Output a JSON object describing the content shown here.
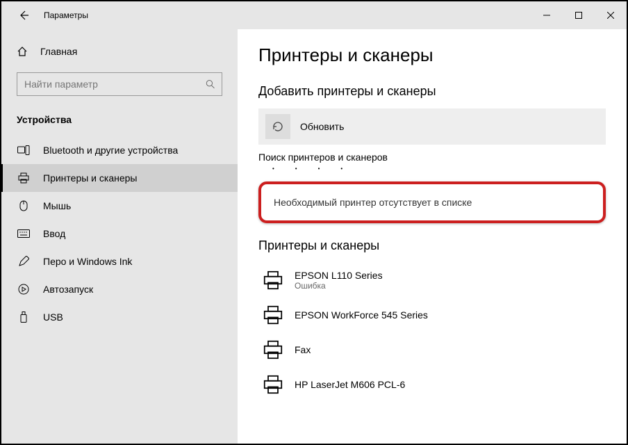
{
  "window": {
    "title": "Параметры"
  },
  "sidebar": {
    "home": "Главная",
    "search_placeholder": "Найти параметр",
    "section": "Устройства",
    "items": [
      {
        "label": "Bluetooth и другие устройства"
      },
      {
        "label": "Принтеры и сканеры"
      },
      {
        "label": "Мышь"
      },
      {
        "label": "Ввод"
      },
      {
        "label": "Перо и Windows Ink"
      },
      {
        "label": "Автозапуск"
      },
      {
        "label": "USB"
      }
    ]
  },
  "main": {
    "title": "Принтеры и сканеры",
    "add_section": "Добавить принтеры и сканеры",
    "refresh": "Обновить",
    "searching": "Поиск принтеров и сканеров",
    "missing_link": "Необходимый принтер отсутствует в списке",
    "list_section": "Принтеры и сканеры",
    "printers": [
      {
        "name": "EPSON L110 Series",
        "status": "Ошибка"
      },
      {
        "name": "EPSON WorkForce 545 Series",
        "status": ""
      },
      {
        "name": "Fax",
        "status": ""
      },
      {
        "name": "HP LaserJet M606 PCL-6",
        "status": ""
      }
    ]
  }
}
